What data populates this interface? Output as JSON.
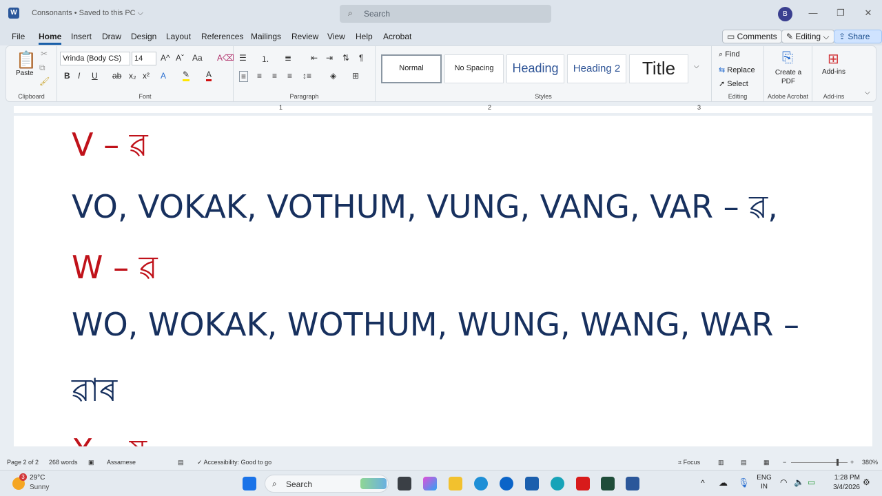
{
  "titlebar": {
    "doc_title": "Consonants • Saved to this PC ⌵",
    "search_placeholder": "Search",
    "user_initial": "B"
  },
  "menu": {
    "tabs": [
      "File",
      "Home",
      "Insert",
      "Draw",
      "Design",
      "Layout",
      "References",
      "Mailings",
      "Review",
      "View",
      "Help",
      "Acrobat"
    ],
    "active_tab": "Home",
    "comments_label": "Comments",
    "editing_label": "Editing",
    "share_label": "Share"
  },
  "ribbon": {
    "clipboard": {
      "paste_label": "Paste",
      "group_label": "Clipboard"
    },
    "font": {
      "font_name": "Vrinda (Body CS)",
      "font_size": "14",
      "group_label": "Font"
    },
    "paragraph": {
      "group_label": "Paragraph"
    },
    "styles": {
      "items": [
        "Normal",
        "No Spacing",
        "Heading",
        "Heading 2",
        "Title"
      ],
      "selected": "Normal",
      "group_label": "Styles"
    },
    "editing": {
      "find_label": "Find",
      "replace_label": "Replace",
      "select_label": "Select",
      "group_label": "Editing"
    },
    "acrobat": {
      "create_pdf_label": "Create a PDF",
      "group_label": "Adobe Acrobat"
    },
    "addins": {
      "label": "Add-ins",
      "group_label": "Add-ins"
    }
  },
  "ruler": {
    "numbers": [
      "1",
      "2",
      "3"
    ]
  },
  "document": {
    "lines": [
      {
        "text": "V  –  ৱ",
        "color": "red"
      },
      {
        "text": "VO, VOKAK, VOTHUM, VUNG, VANG, VAR  –  ৱ,",
        "color": "blue"
      },
      {
        "text": "W  –  ৱ",
        "color": "red"
      },
      {
        "text": "WO, WOKAK, WOTHUM, WUNG, WANG, WAR  –",
        "color": "blue"
      },
      {
        "text": "ৱাৰ",
        "color": "blue"
      },
      {
        "text": "X  –  ষ",
        "color": "red"
      }
    ]
  },
  "status": {
    "page": "Page 2 of 2",
    "words": "268 words",
    "language": "Assamese",
    "accessibility": "Accessibility: Good to go",
    "focus": "Focus",
    "zoom": "380%"
  },
  "taskbar": {
    "weather_temp": "29°C",
    "weather_desc": "Sunny",
    "weather_badge": "3",
    "search_label": "Search",
    "lang_line1": "ENG",
    "lang_line2": "IN",
    "time": "1:28 PM",
    "date": "3/4/2026"
  },
  "colors": {
    "red_text": "#c0121a",
    "blue_text": "#17305e",
    "accent": "#1a5fa8"
  }
}
